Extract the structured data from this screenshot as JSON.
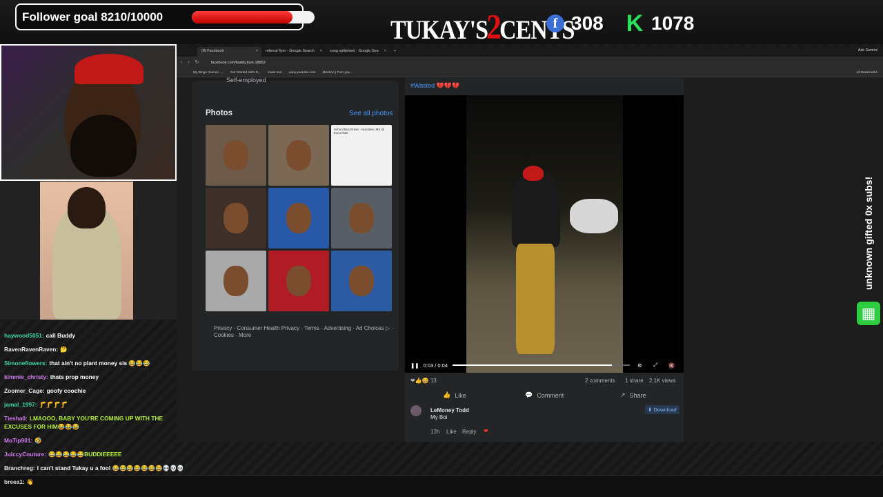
{
  "overlay": {
    "goal_label": "Follower goal 8210/10000",
    "goal_progress": 0.821,
    "logo_left": "TUKAY'S",
    "logo_mid": "2",
    "logo_right": "CENTS",
    "facebook_count": "308",
    "kick_count": "1078",
    "facebook_icon": "f",
    "kick_icon": "K",
    "sub_banner": "unknown gifted 0x subs!",
    "sub_icon": "gift-icon"
  },
  "chat": [
    {
      "user": "haywood5051",
      "text": "call Buddy",
      "color": "#3dd6a3"
    },
    {
      "user": "RavenRavenRaven",
      "text": "🤔",
      "color": "#f5f5f5"
    },
    {
      "user": "Simoneflowers",
      "text": "that ain't no plant money sis 😂😂😂",
      "color": "#3dd6a3"
    },
    {
      "user": "kimmie_christy",
      "text": "thats prop money",
      "color": "#d77cf5"
    },
    {
      "user": "Zoomer_Cage",
      "text": "goofy coochie",
      "color": "#f5f5f5"
    },
    {
      "user": "jamal_1997",
      "text": "🦵🦵🦵🦵",
      "color": "#3dd6a3"
    },
    {
      "user": "Tiesha0",
      "text": "LMAOOO, BABY YOU'RE COMING UP WITH THE",
      "color": "#d77cf5"
    },
    {
      "user": "",
      "text": "EXCUSES FOR HIM😂😂😂",
      "color": "#b6f33b"
    },
    {
      "user": "MoTip901",
      "text": "🤣",
      "color": "#d77cf5"
    },
    {
      "user": "JuiccyCouture",
      "text": "😂😂😂😂😂BUDDIEEEEE",
      "color": "#d77cf5"
    },
    {
      "user": "Branchreg",
      "text": "I can't stand Tukay u a fool 😂😂😂😂😂😂😂💀💀💀",
      "color": "#f5f5f5"
    }
  ],
  "last_chat": {
    "user": "breea1",
    "text": "👋"
  },
  "browser": {
    "tabs": [
      {
        "label": "(8) Facebook",
        "active": true
      },
      {
        "label": "referral flyer - Google Search",
        "active": false
      },
      {
        "label": "song splitsheet - Google Sea",
        "active": false
      }
    ],
    "new_tab": "+",
    "ask": "Ask Gemini",
    "url": "facebook.com/buddy.love.18852",
    "bookmarks": [
      "My Bingo Games -...",
      "Get Started With R...",
      "mass text",
      "www.youtube.com",
      "Mention | Turn you..."
    ],
    "all_bookmarks": "All Bookmarks"
  },
  "profile": {
    "self_employed": "Self-employed",
    "photos_title": "Photos",
    "see_all": "See all photos",
    "flyer_title": "School Bus Driver - Nozubee, MS @ Ecco Ride",
    "legal": "Privacy · Consumer Health Privacy · Terms · Advertising · Ad Choices ▷ · Cookies · More"
  },
  "post": {
    "hashtag": "#Wasted 💔💔💔",
    "time": "0:03 / 0:04",
    "progress": 0.9,
    "reactions": "13",
    "comments": "2 comments",
    "shares": "1 share",
    "views": "2.1K views",
    "like": "Like",
    "comment": "Comment",
    "share": "Share",
    "commenter": "LeMoney Todd",
    "comment_text": "My Boi",
    "comment_age": "12h",
    "comment_like": "Like",
    "comment_reply": "Reply",
    "download": "Download"
  }
}
